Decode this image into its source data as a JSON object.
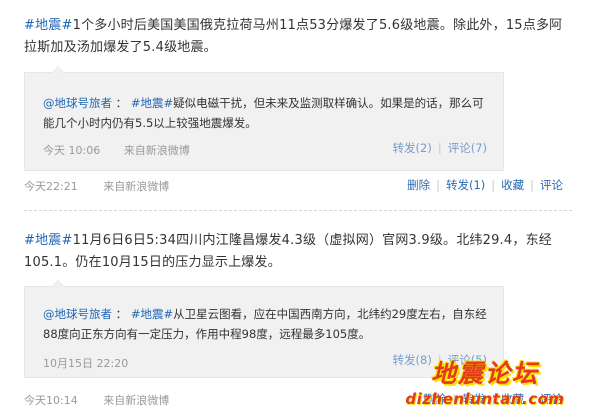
{
  "posts": [
    {
      "tag": "#地震#",
      "text": "1个多小时后美国美国俄克拉荷马州11点53分爆发了5.6级地震。除此外，15点多阿拉斯加及汤加爆发了5.4级地震。",
      "repost": {
        "user": "@地球号旅者",
        "colon": "：",
        "tag": "#地震#",
        "text": "疑似电磁干扰，但未来及监测取样确认。如果是的话，那么可能几个小时内仍有5.5以上较强地震爆发。",
        "time": "今天 10:06",
        "source": "来自新浪微博",
        "actions": [
          "转发(2)",
          "评论(7)"
        ]
      },
      "time": "今天22:21",
      "source": "来自新浪微博",
      "actions": [
        "删除",
        "转发(1)",
        "收藏",
        "评论"
      ]
    },
    {
      "tag": "#地震#",
      "text": "11月6日6日5:34四川内江隆昌爆发4.3级（虚拟网）官网3.9级。北纬29.4，东经105.1。仍在10月15日的压力显示上爆发。",
      "repost": {
        "user": "@地球号旅者",
        "colon": "：",
        "tag": "#地震#",
        "text": "从卫星云图看，应在中国西南方向，北纬约29度左右，自东经88度向正东方向有一定压力，作用中程98度，远程最多105度。",
        "time": "10月15日 22:20",
        "source": "来自新浪微博",
        "actions": [
          "转发(8)",
          "评论(5)"
        ]
      },
      "time": "今天10:14",
      "source": "来自新浪微博",
      "actions": [
        "删除",
        "转发",
        "收藏",
        "评论"
      ]
    }
  ],
  "watermark": {
    "cn": "地震论坛",
    "url": "dizhenluntan.com"
  },
  "colors": {
    "link": "#1f67b5",
    "muted": "#9a9a9a",
    "repost_bg": "#f1f1f1",
    "watermark": "#e23a1a"
  }
}
